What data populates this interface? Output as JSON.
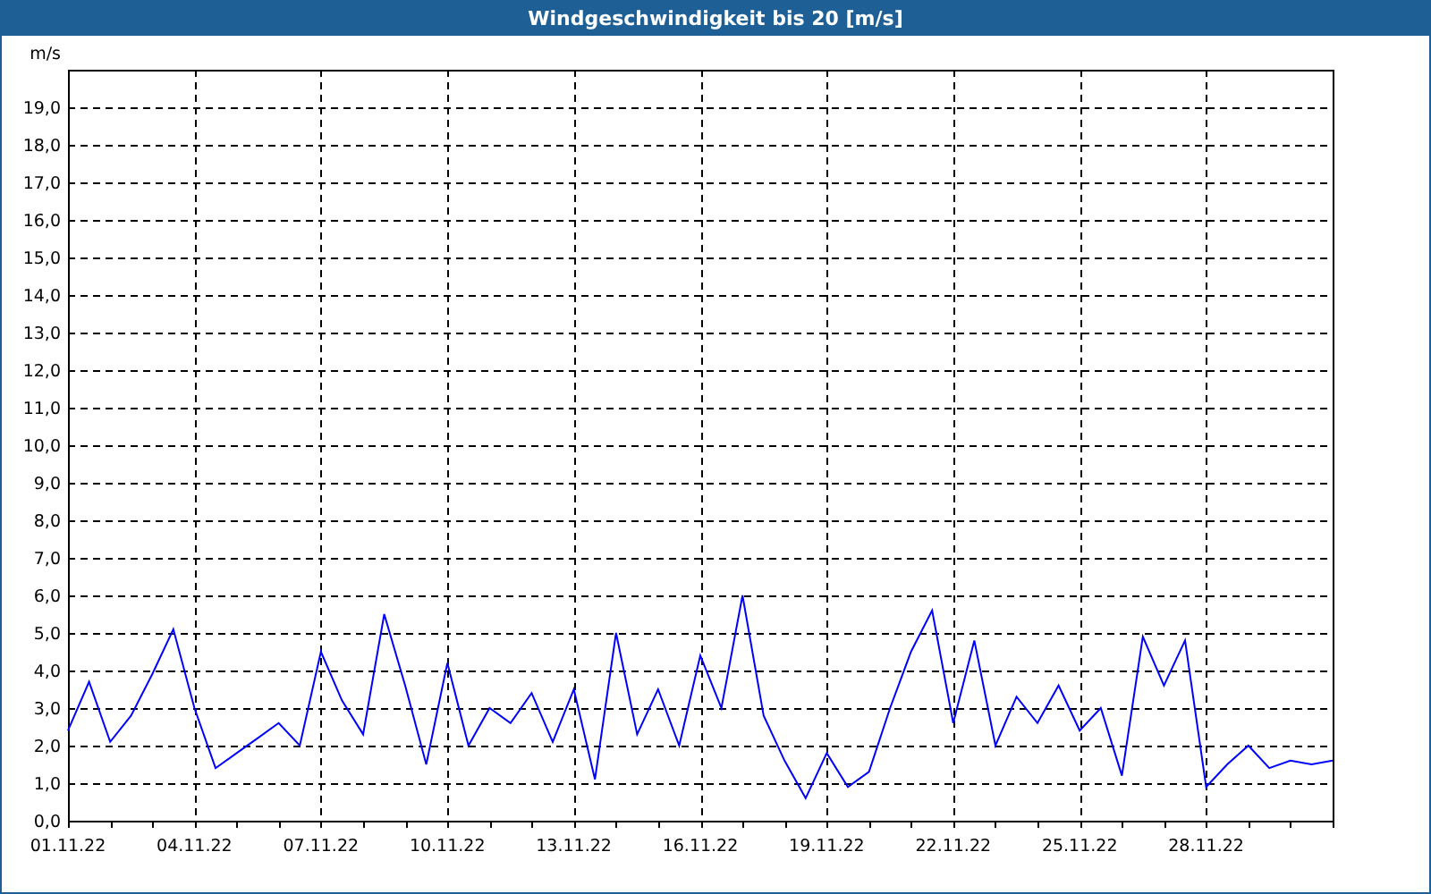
{
  "window": {
    "title": "Windgeschwindigkeit bis 20 [m/s]"
  },
  "chart": {
    "chart_data": {
      "type": "line",
      "ylabel": "m/s",
      "categories": [
        "01.11.22",
        null,
        null,
        null,
        null,
        null,
        "04.11.22",
        null,
        null,
        null,
        null,
        null,
        "07.11.22",
        null,
        null,
        null,
        null,
        null,
        "10.11.22",
        null,
        null,
        null,
        null,
        null,
        "13.11.22",
        null,
        null,
        null,
        null,
        null,
        "16.11.22",
        null,
        null,
        null,
        null,
        null,
        "19.11.22",
        null,
        null,
        null,
        null,
        null,
        "22.11.22",
        null,
        null,
        null,
        null,
        null,
        "25.11.22",
        null,
        null,
        null,
        null,
        null,
        "28.11.22",
        null,
        null,
        null,
        null,
        null,
        null
      ],
      "series": [
        {
          "color": "#0000ff",
          "values": [
            2.4,
            3.7,
            2.1,
            2.8,
            3.9,
            5.1,
            3.0,
            1.4,
            1.8,
            2.2,
            2.6,
            2.0,
            4.5,
            3.2,
            2.3,
            5.5,
            3.6,
            1.5,
            4.2,
            2.0,
            3.0,
            2.6,
            3.4,
            2.1,
            3.5,
            1.1,
            5.0,
            2.3,
            3.5,
            2.0,
            4.4,
            3.0,
            6.0,
            2.8,
            1.6,
            0.6,
            1.8,
            0.9,
            1.3,
            3.0,
            4.5,
            5.6,
            2.6,
            4.8,
            2.0,
            3.3,
            2.6,
            3.6,
            2.4,
            3.0,
            1.2,
            4.9,
            3.6,
            4.8,
            0.9,
            1.5,
            2.0,
            1.4,
            1.6,
            1.5,
            1.6
          ]
        }
      ],
      "ylim": [
        0,
        20
      ],
      "grid": true,
      "yticks": [
        {
          "value": 0,
          "label": "0,0"
        },
        {
          "value": 1,
          "label": "1,0"
        },
        {
          "value": 2,
          "label": "2,0"
        },
        {
          "value": 3,
          "label": "3,0"
        },
        {
          "value": 4,
          "label": "4,0"
        },
        {
          "value": 5,
          "label": "5,0"
        },
        {
          "value": 6,
          "label": "6,0"
        },
        {
          "value": 7,
          "label": "7,0"
        },
        {
          "value": 8,
          "label": "8,0"
        },
        {
          "value": 9,
          "label": "9,0"
        },
        {
          "value": 10,
          "label": "10,0"
        },
        {
          "value": 11,
          "label": "11,0"
        },
        {
          "value": 12,
          "label": "12,0"
        },
        {
          "value": 13,
          "label": "13,0"
        },
        {
          "value": 14,
          "label": "14,0"
        },
        {
          "value": 15,
          "label": "15,0"
        },
        {
          "value": 16,
          "label": "16,0"
        },
        {
          "value": 17,
          "label": "17,0"
        },
        {
          "value": 18,
          "label": "18,0"
        },
        {
          "value": 19,
          "label": "19,0"
        }
      ]
    }
  }
}
